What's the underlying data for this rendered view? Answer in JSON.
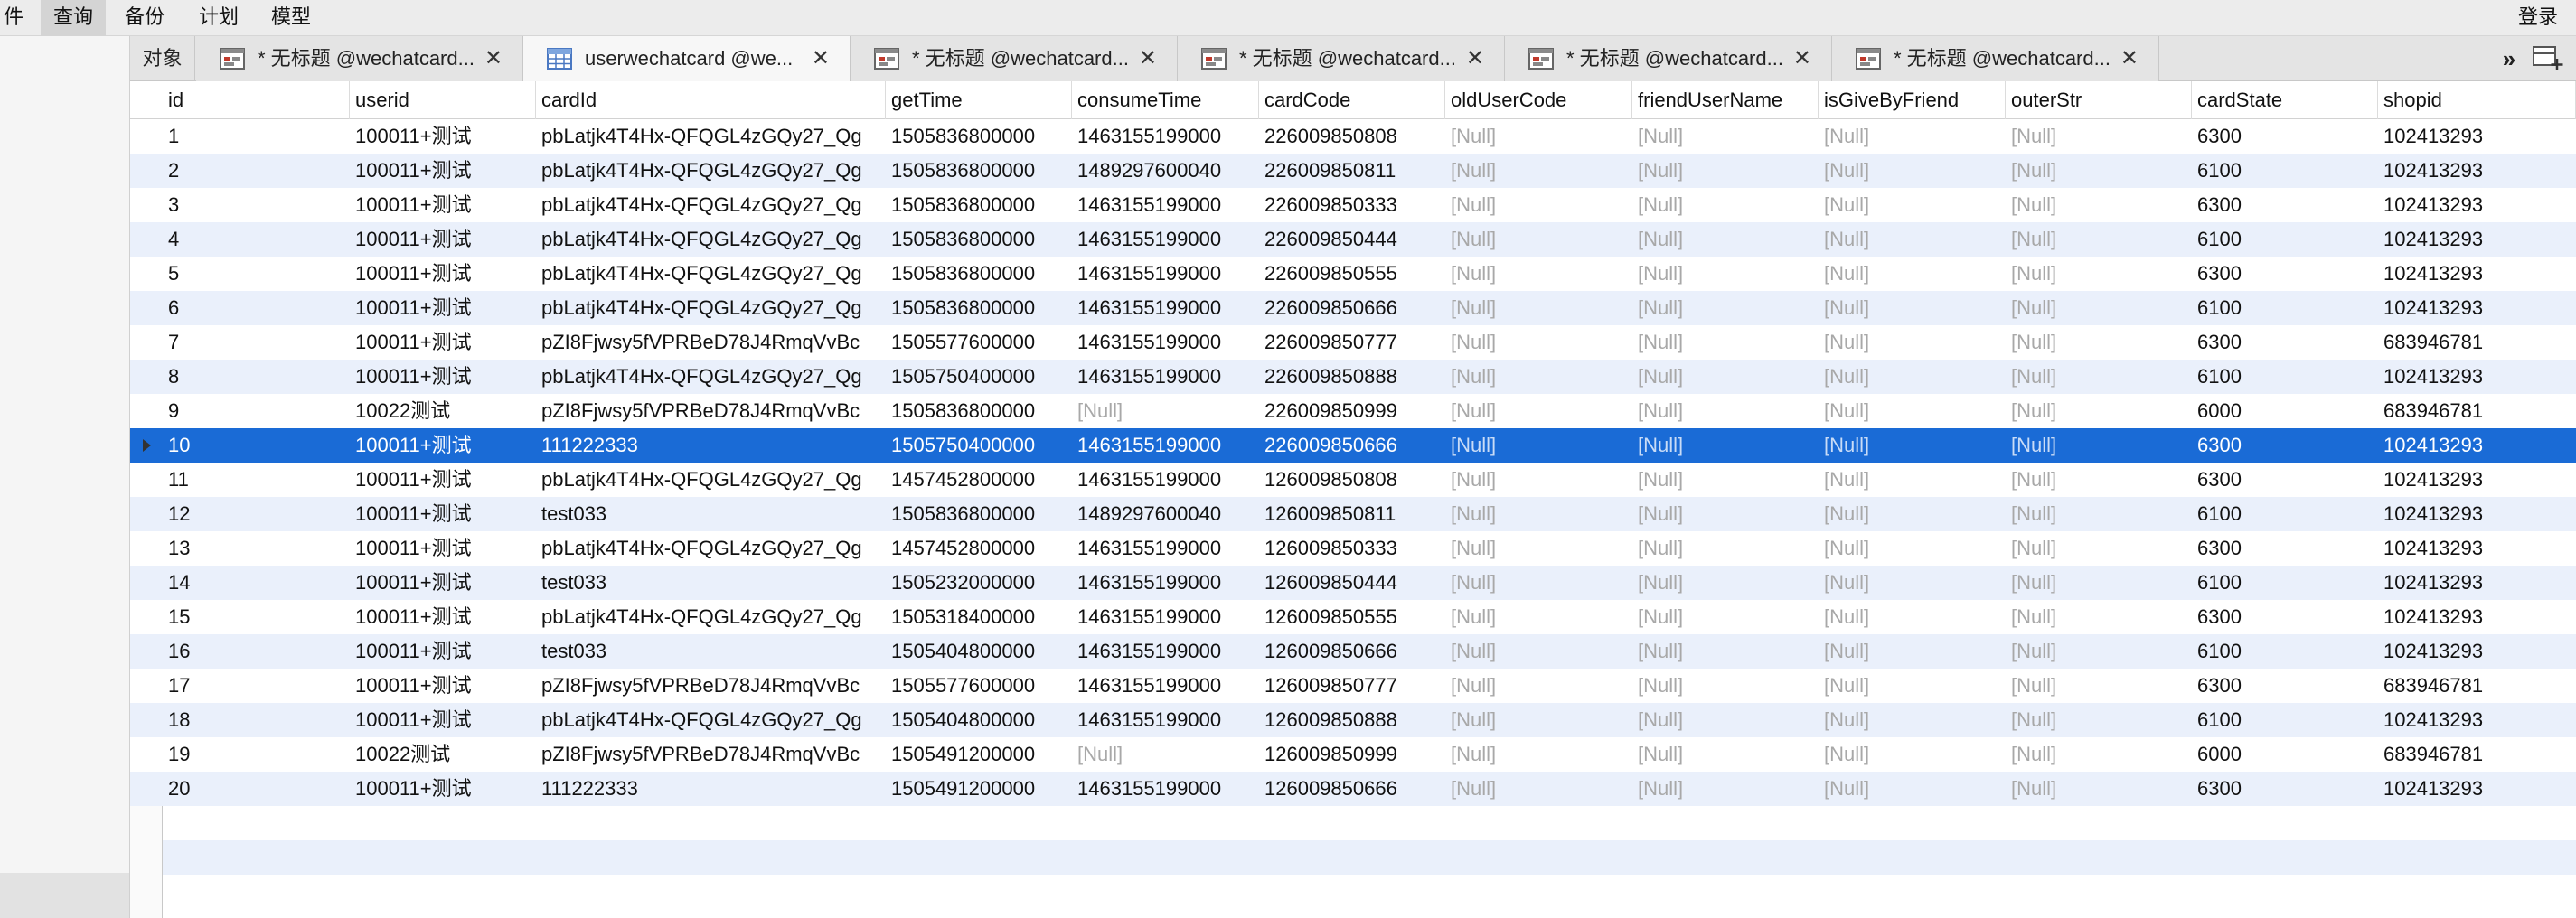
{
  "menu": {
    "items": [
      "件",
      "查询",
      "备份",
      "计划",
      "模型"
    ],
    "active_index": 1,
    "login": "登录"
  },
  "tabs": {
    "objects_label": "对象",
    "items": [
      {
        "label": "* 无标题 @wechatcard...",
        "icon": "query-icon",
        "active": false
      },
      {
        "label": "userwechatcard @we...",
        "icon": "table-icon",
        "active": true
      },
      {
        "label": "* 无标题 @wechatcard...",
        "icon": "query-icon",
        "active": false
      },
      {
        "label": "* 无标题 @wechatcard...",
        "icon": "query-icon",
        "active": false
      },
      {
        "label": "* 无标题 @wechatcard...",
        "icon": "query-icon",
        "active": false
      },
      {
        "label": "* 无标题 @wechatcard...",
        "icon": "query-icon",
        "active": false
      }
    ],
    "close_glyph": "✕",
    "more_glyph": "»"
  },
  "table": {
    "columns": [
      "id",
      "userid",
      "cardId",
      "getTime",
      "consumeTime",
      "cardCode",
      "oldUserCode",
      "friendUserName",
      "isGiveByFriend",
      "outerStr",
      "cardState",
      "shopid"
    ],
    "null_text": "[Null]",
    "selected_row_index": 9,
    "rows": [
      [
        "1",
        "100011+测试",
        "pbLatjk4T4Hx-QFQGL4zGQy27_Qg",
        "1505836800000",
        "1463155199000",
        "226009850808",
        null,
        null,
        null,
        null,
        "6300",
        "102413293"
      ],
      [
        "2",
        "100011+测试",
        "pbLatjk4T4Hx-QFQGL4zGQy27_Qg",
        "1505836800000",
        "1489297600040",
        "226009850811",
        null,
        null,
        null,
        null,
        "6100",
        "102413293"
      ],
      [
        "3",
        "100011+测试",
        "pbLatjk4T4Hx-QFQGL4zGQy27_Qg",
        "1505836800000",
        "1463155199000",
        "226009850333",
        null,
        null,
        null,
        null,
        "6300",
        "102413293"
      ],
      [
        "4",
        "100011+测试",
        "pbLatjk4T4Hx-QFQGL4zGQy27_Qg",
        "1505836800000",
        "1463155199000",
        "226009850444",
        null,
        null,
        null,
        null,
        "6100",
        "102413293"
      ],
      [
        "5",
        "100011+测试",
        "pbLatjk4T4Hx-QFQGL4zGQy27_Qg",
        "1505836800000",
        "1463155199000",
        "226009850555",
        null,
        null,
        null,
        null,
        "6300",
        "102413293"
      ],
      [
        "6",
        "100011+测试",
        "pbLatjk4T4Hx-QFQGL4zGQy27_Qg",
        "1505836800000",
        "1463155199000",
        "226009850666",
        null,
        null,
        null,
        null,
        "6100",
        "102413293"
      ],
      [
        "7",
        "100011+测试",
        "pZI8Fjwsy5fVPRBeD78J4RmqVvBc",
        "1505577600000",
        "1463155199000",
        "226009850777",
        null,
        null,
        null,
        null,
        "6300",
        "683946781"
      ],
      [
        "8",
        "100011+测试",
        "pbLatjk4T4Hx-QFQGL4zGQy27_Qg",
        "1505750400000",
        "1463155199000",
        "226009850888",
        null,
        null,
        null,
        null,
        "6100",
        "102413293"
      ],
      [
        "9",
        "10022测试",
        "pZI8Fjwsy5fVPRBeD78J4RmqVvBc",
        "1505836800000",
        null,
        "226009850999",
        null,
        null,
        null,
        null,
        "6000",
        "683946781"
      ],
      [
        "10",
        "100011+测试",
        "111222333",
        "1505750400000",
        "1463155199000",
        "226009850666",
        null,
        null,
        null,
        null,
        "6300",
        "102413293"
      ],
      [
        "11",
        "100011+测试",
        "pbLatjk4T4Hx-QFQGL4zGQy27_Qg",
        "1457452800000",
        "1463155199000",
        "126009850808",
        null,
        null,
        null,
        null,
        "6300",
        "102413293"
      ],
      [
        "12",
        "100011+测试",
        "test033",
        "1505836800000",
        "1489297600040",
        "126009850811",
        null,
        null,
        null,
        null,
        "6100",
        "102413293"
      ],
      [
        "13",
        "100011+测试",
        "pbLatjk4T4Hx-QFQGL4zGQy27_Qg",
        "1457452800000",
        "1463155199000",
        "126009850333",
        null,
        null,
        null,
        null,
        "6300",
        "102413293"
      ],
      [
        "14",
        "100011+测试",
        "test033",
        "1505232000000",
        "1463155199000",
        "126009850444",
        null,
        null,
        null,
        null,
        "6100",
        "102413293"
      ],
      [
        "15",
        "100011+测试",
        "pbLatjk4T4Hx-QFQGL4zGQy27_Qg",
        "1505318400000",
        "1463155199000",
        "126009850555",
        null,
        null,
        null,
        null,
        "6300",
        "102413293"
      ],
      [
        "16",
        "100011+测试",
        "test033",
        "1505404800000",
        "1463155199000",
        "126009850666",
        null,
        null,
        null,
        null,
        "6100",
        "102413293"
      ],
      [
        "17",
        "100011+测试",
        "pZI8Fjwsy5fVPRBeD78J4RmqVvBc",
        "1505577600000",
        "1463155199000",
        "126009850777",
        null,
        null,
        null,
        null,
        "6300",
        "683946781"
      ],
      [
        "18",
        "100011+测试",
        "pbLatjk4T4Hx-QFQGL4zGQy27_Qg",
        "1505404800000",
        "1463155199000",
        "126009850888",
        null,
        null,
        null,
        null,
        "6100",
        "102413293"
      ],
      [
        "19",
        "10022测试",
        "pZI8Fjwsy5fVPRBeD78J4RmqVvBc",
        "1505491200000",
        null,
        "126009850999",
        null,
        null,
        null,
        null,
        "6000",
        "683946781"
      ],
      [
        "20",
        "100011+测试",
        "111222333",
        "1505491200000",
        "1463155199000",
        "126009850666",
        null,
        null,
        null,
        null,
        "6300",
        "102413293"
      ]
    ]
  },
  "colors": {
    "selection": "#1a6bd6",
    "stripe": "#eaf0fb",
    "null_text": "#a8a8a8"
  }
}
